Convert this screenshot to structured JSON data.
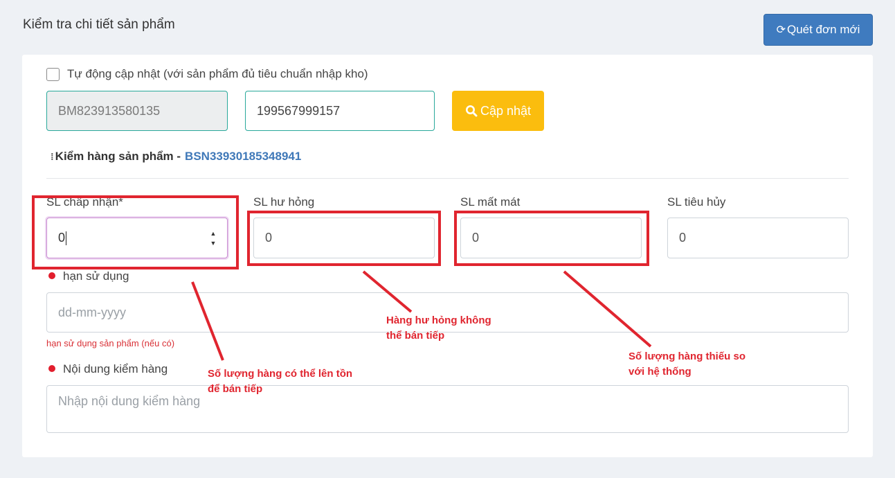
{
  "header": {
    "title": "Kiểm tra chi tiết sản phẩm",
    "rescan_icon": "refresh-icon",
    "rescan_label": "Quét đơn mới"
  },
  "auto_update": {
    "checked": false,
    "label": "Tự động cập nhật (với sản phẩm đủ tiêu chuẩn nhập kho)"
  },
  "lookup": {
    "order_code": "BM823913580135",
    "tracking_code": "199567999157",
    "update_icon": "search-icon",
    "update_label": "Cập nhật"
  },
  "section": {
    "title_prefix": "Kiểm hàng sản phẩm - ",
    "product_code": "BSN33930185348941"
  },
  "quantities": {
    "accepted": {
      "label": "SL chấp nhận*",
      "value": "0"
    },
    "damaged": {
      "label": "SL hư hỏng",
      "value": "0"
    },
    "lost": {
      "label": "SL mất mát",
      "value": "0"
    },
    "destroyed": {
      "label": "SL tiêu hủy",
      "value": "0"
    }
  },
  "expiry": {
    "label": "hạn sử dụng",
    "placeholder": "dd-mm-yyyy",
    "hint": "hạn sử dụng sản phẩm (nếu có)"
  },
  "inspection": {
    "label": "Nội dung kiểm hàng",
    "placeholder": "Nhập nội dung kiểm hàng"
  },
  "annotations": {
    "accepted_note": [
      "Số lượng hàng có thể lên tồn",
      "để bán tiếp"
    ],
    "damaged_note": [
      "Hàng hư hỏng không",
      "thể bán tiếp"
    ],
    "lost_note": [
      "Số lượng hàng thiếu so",
      "với hệ thống"
    ]
  },
  "colors": {
    "primary": "#3f7bbf",
    "warning": "#fbbd0e",
    "annotation": "#e0252f",
    "link": "#3f78b8"
  }
}
